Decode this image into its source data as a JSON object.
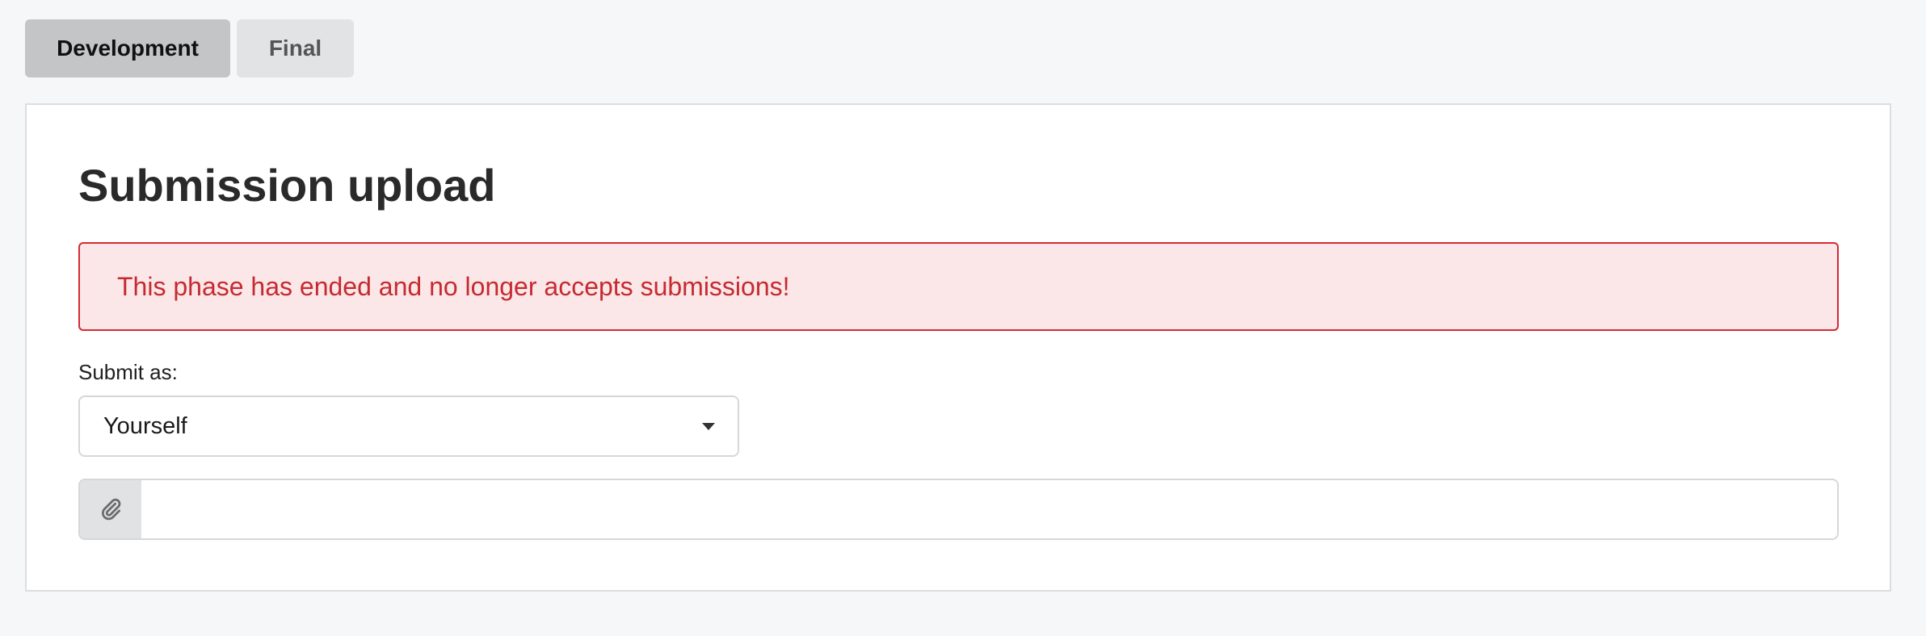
{
  "tabs": [
    {
      "label": "Development",
      "active": true
    },
    {
      "label": "Final",
      "active": false
    }
  ],
  "panel": {
    "title": "Submission upload",
    "alert": {
      "text": "This phase has ended and no longer accepts submissions!",
      "color": "#c62a31"
    },
    "submit_as": {
      "label": "Submit as:",
      "selected": "Yourself",
      "icon": "caret-down-icon"
    },
    "file": {
      "icon": "paperclip-icon",
      "value": ""
    }
  }
}
